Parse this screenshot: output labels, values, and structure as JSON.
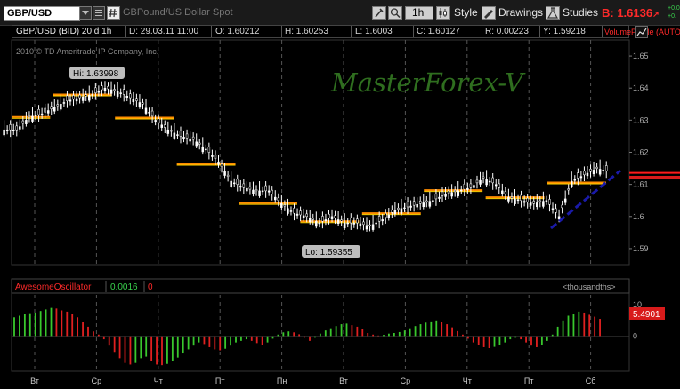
{
  "toolbar": {
    "symbol": "GBP/USD",
    "description": "GBPound/US Dollar Spot",
    "timeframe": "1h",
    "style_label": "Style",
    "drawings_label": "Drawings",
    "studies_label": "Studies",
    "bid_label": "B: 1.6136",
    "bid_arrow": "↗",
    "right_tiny_1": "+0.0",
    "right_tiny_2": "+0."
  },
  "infobar": {
    "instrument": "GBP/USD (BID) 20 d 1h",
    "date": "D: 29.03.11 11:00",
    "open": "O: 1.60212",
    "high": "H: 1.60253",
    "low": "L: 1.6003",
    "close": "C: 1.60127",
    "range": "R: 0.00223",
    "y": "Y: 1.59218",
    "study": "VolumeProfile (AUTO..."
  },
  "chart": {
    "copyright": "2010 © TD Ameritrade IP Company, Inc.",
    "watermark": "MasterForex-V",
    "hi_label": "Hi: 1.63998",
    "lo_label": "Lo: 1.59355",
    "price_ticks": [
      "1.65",
      "1.64",
      "1.63",
      "1.62",
      "1.61",
      "1.6",
      "1.59"
    ],
    "day_labels": [
      "Вт",
      "Ср",
      "Чт",
      "Пт",
      "Пн",
      "Вт",
      "Ср",
      "Чт",
      "Пт",
      "Сб"
    ],
    "colors": {
      "candle": "#ffffff",
      "level_line": "#ff8c00",
      "level_line_yellow": "#ffd700",
      "trend_line": "#1a1aa8",
      "current_price_line": "#ff1a1a",
      "watermark": "#2f6e1f",
      "osc_up": "#39c82d",
      "osc_down": "#e02020"
    }
  },
  "oscillator": {
    "name": "AwesomeOscillator",
    "value": "0.0016",
    "extra": "0",
    "unit_label": "<thousandths>",
    "axis_ticks": [
      "10",
      "0"
    ],
    "current_value": "5.4901"
  },
  "chart_data": [
    {
      "type": "line",
      "title": "GBP/USD (BID) 20 d 1h",
      "ylim": [
        1.585,
        1.655
      ],
      "y_ticks": [
        1.59,
        1.6,
        1.61,
        1.62,
        1.63,
        1.64,
        1.65
      ],
      "grid": true,
      "x_categories": [
        "Вт",
        "Ср",
        "Чт",
        "Пт",
        "Пн",
        "Вт",
        "Ср",
        "Чт",
        "Пт",
        "Сб"
      ],
      "series": [
        {
          "values": [
            1.627,
            1.631,
            1.632,
            1.634,
            1.636,
            1.637,
            1.638,
            1.64,
            1.639,
            1.637,
            1.635,
            1.63,
            1.627,
            1.625,
            1.624,
            1.621,
            1.617,
            1.611,
            1.609,
            1.608,
            1.608,
            1.604,
            1.601,
            1.6,
            1.598,
            1.6,
            1.598,
            1.598,
            1.597,
            1.599,
            1.602,
            1.603,
            1.604,
            1.605,
            1.607,
            1.608,
            1.609,
            1.612,
            1.61,
            1.606,
            1.605,
            1.604,
            1.605,
            1.6,
            1.611,
            1.613,
            1.615,
            1.614
          ]
        }
      ],
      "annotations": [
        "Hi: 1.63998",
        "Lo: 1.59355"
      ],
      "current_price": 1.6136
    },
    {
      "type": "bar",
      "title": "AwesomeOscillator",
      "ylim": [
        -10,
        12
      ],
      "y_ticks": [
        10,
        0
      ],
      "current_value": 5.4901,
      "values": [
        6,
        6.5,
        7,
        7.3,
        7.5,
        8,
        8.5,
        9,
        8.8,
        8.2,
        7.8,
        7,
        6,
        4.5,
        3,
        1.5,
        0.5,
        -1,
        -3,
        -5,
        -7,
        -8.5,
        -9,
        -8.5,
        -7,
        -6.5,
        -8,
        -9,
        -9.2,
        -8.8,
        -8,
        -6.8,
        -5.5,
        -4.2,
        -3,
        -2,
        -2.5,
        -3.5,
        -4.2,
        -4.5,
        -4,
        -3,
        -2,
        -1.5,
        -1,
        -1.5,
        -2.2,
        -2.8,
        -2,
        -0.8,
        0.5,
        1.2,
        1.5,
        1.2,
        0.6,
        -0.5,
        -1.5,
        -0.5,
        0.8,
        1.8,
        2.5,
        3.2,
        3.8,
        4,
        3.5,
        3,
        2.2,
        1,
        0.5,
        0.2,
        0.4,
        0.8,
        1,
        1.3,
        1.8,
        2.5,
        3.2,
        3.8,
        4.3,
        4.7,
        5,
        4.6,
        3.8,
        2.8,
        1.6,
        0.5,
        -0.8,
        -2,
        -2.9,
        -3.5,
        -3.8,
        -3.4,
        -2.8,
        -2,
        -1,
        -0.5,
        -1,
        -2,
        -3,
        -3.5,
        -2.8,
        -1.5,
        0.5,
        3,
        5,
        6.5,
        7.2,
        7.8,
        7.5,
        6.8,
        6.2,
        5.5
      ]
    }
  ]
}
